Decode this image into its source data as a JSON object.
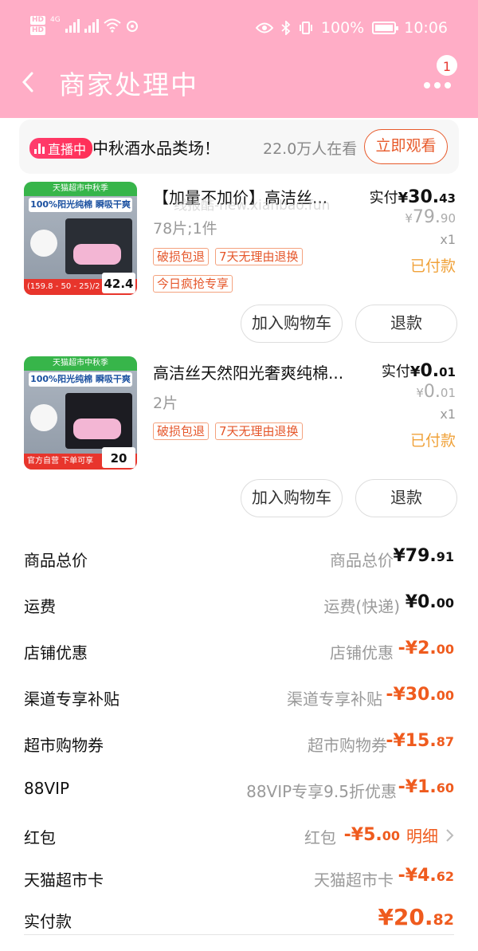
{
  "status_bar": {
    "hd1": "HD",
    "hd2": "HD",
    "network": "4G",
    "battery": "100%",
    "time": "10:06"
  },
  "header": {
    "title": "商家处理中",
    "badge_count": "1",
    "bg_color": "#ffadc6"
  },
  "live": {
    "tag": "直播中",
    "title": "中秋酒水品类场！",
    "viewers": "22.0万人在看",
    "watch_button": "立即观看"
  },
  "watermark": "线报酷-new.xianbao.fun",
  "products": [
    {
      "title": "【加量不加价】高洁丝...",
      "spec": "78片;1件",
      "tags": [
        "破损包退",
        "7天无理由退换",
        "今日疯抢专享"
      ],
      "paid_label": "实付",
      "paid_currency": "¥",
      "paid_int": "30.",
      "paid_dec": "43",
      "orig_currency": "¥",
      "orig_int": "79.",
      "orig_dec": "90",
      "qty": "x1",
      "status": "已付款",
      "add_cart": "加入购物车",
      "refund": "退款",
      "thumb": {
        "top": "天猫超市中秋季",
        "sub": "100%阳光纯棉 瞬吸干爽",
        "bottom": "(159.8 - 50 - 25)/2 =",
        "price": "42.4"
      }
    },
    {
      "title": "高洁丝天然阳光奢爽纯棉...",
      "spec": "2片",
      "tags": [
        "破损包退",
        "7天无理由退换"
      ],
      "paid_label": "实付",
      "paid_currency": "¥",
      "paid_int": "0.",
      "paid_dec": "01",
      "orig_currency": "¥",
      "orig_int": "0.",
      "orig_dec": "01",
      "qty": "x1",
      "status": "已付款",
      "add_cart": "加入购物车",
      "refund": "退款",
      "thumb": {
        "top": "天猫超市中秋季",
        "sub": "100%阳光纯棉 瞬吸干爽",
        "bottom": "官方自营 下单可享",
        "price": "20"
      }
    }
  ],
  "summary": [
    {
      "label": "商品总价",
      "detail": "商品总价",
      "amount_int": "¥79.",
      "amount_dec": "91",
      "negative": false
    },
    {
      "label": "运费",
      "detail": "运费(快递)",
      "amount_int": "¥0.",
      "amount_dec": "00",
      "negative": false
    },
    {
      "label": "店铺优惠",
      "detail": "店铺优惠",
      "amount_int": "-¥2.",
      "amount_dec": "00",
      "negative": true
    },
    {
      "label": "渠道专享补贴",
      "detail": "渠道专享补贴",
      "amount_int": "-¥30.",
      "amount_dec": "00",
      "negative": true
    },
    {
      "label": "超市购物券",
      "detail": "超市购物券",
      "amount_int": "-¥15.",
      "amount_dec": "87",
      "negative": true
    },
    {
      "label": "88VIP",
      "detail": "88VIP专享9.5折优惠",
      "amount_int": "-¥1.",
      "amount_dec": "60",
      "negative": true
    },
    {
      "label": "红包",
      "detail": "红包",
      "amount_int": "-¥5.",
      "amount_dec": "00",
      "negative": true,
      "link": "明细"
    },
    {
      "label": "天猫超市卡",
      "detail": "天猫超市卡",
      "amount_int": "-¥4.",
      "amount_dec": "62",
      "negative": true
    }
  ],
  "total": {
    "label": "实付款",
    "amount_int": "¥20.",
    "amount_dec": "82"
  }
}
